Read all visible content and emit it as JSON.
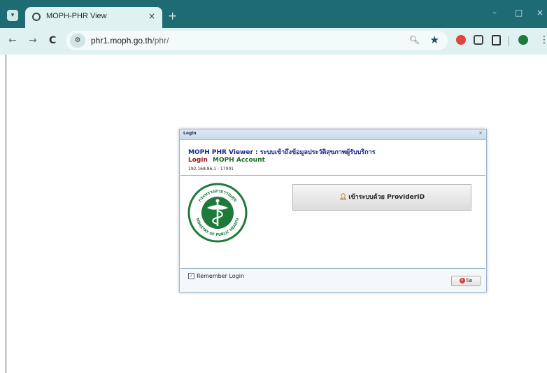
{
  "browser": {
    "tab_title": "MOPH-PHR View",
    "tab_close": "×",
    "new_tab": "+",
    "url_host": "phr1.moph.go.th",
    "url_path": "/phr/",
    "nav_back": "←",
    "nav_forward": "→",
    "nav_reload": "C",
    "zoom_icon": "magnifier-icon",
    "bookmark_icon": "star-icon",
    "win_min": "–",
    "win_max": "□",
    "win_close": "×",
    "menu": "⋮"
  },
  "dialog": {
    "title": "Login",
    "close": "×",
    "heading": "MOPH PHR Viewer : ระบบเข้าถึงข้อมูลประวัติสุขภาพผู้รับบริการ",
    "login_label": "Login",
    "account_label": "MOPH Account",
    "server": "192.168.86.1 : 17001",
    "provider_button": "เข้าระบบด้วย ProviderID",
    "remember_label": "Remember Login",
    "remember_checked": "✓",
    "close_button": "ปิด",
    "logo_text_top": "กระทรวงสาธารณสุข",
    "logo_text_bottom": "MINISTRY OF PUBLIC HEALTH",
    "logo_color": "#1e7a3a"
  }
}
